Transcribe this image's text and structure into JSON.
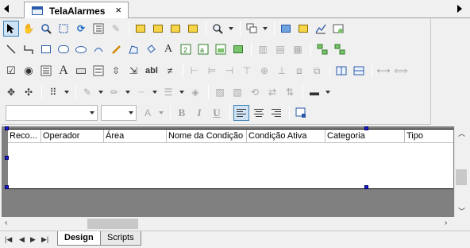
{
  "document_tab": {
    "title": "TelaAlarmes",
    "close_glyph": "×",
    "icon": "screen-window-icon"
  },
  "toolbar": {
    "row1_icons": [
      "pointer-arrow-icon",
      "hand-pan-icon",
      "zoom-icon",
      "refresh-icon",
      "list-checklist-icon",
      "clear-format-icon",
      "bring-forward-icon",
      "send-backward-icon",
      "bring-to-front-icon",
      "send-to-back-icon",
      "magnifier-zoom-icon",
      "dropdown-caret",
      "group-objects-icon",
      "dropdown-caret",
      "screen-properties-icon",
      "screen-resize-icon",
      "chart-icon",
      "object-wizard-icon"
    ],
    "row2_icons": [
      "line-icon",
      "polyline-icon",
      "rectangle-icon",
      "rounded-rectangle-icon",
      "ellipse-icon",
      "arc-icon",
      "pencil-icon",
      "polygon-icon",
      "bucket-fill-icon",
      "text-A-icon",
      "numeric-display-icon",
      "text-display-icon",
      "image-display-icon",
      "smart-object-icon",
      "align-left-grid-icon",
      "align-top-grid-icon",
      "tile-icon",
      "ungroup-icon"
    ],
    "row3_icons": [
      "checkbox-icon",
      "radio-button-icon",
      "listbox-icon",
      "text-big-A-icon",
      "button-icon",
      "combo-icon",
      "spin-icon",
      "edit-field-icon",
      "abl-text-icon",
      "slider-icon",
      "align-left-icon",
      "align-center-icon",
      "align-right-icon",
      "align-top-icon",
      "align-middle-icon",
      "align-bottom-icon",
      "space-horizontal-icon",
      "space-vertical-icon",
      "same-width-icon",
      "same-height-icon"
    ],
    "row4_icons": [
      "move-icon",
      "resize-icon",
      "grid-dots-icon",
      "line-color-icon",
      "text-color-icon",
      "line-style-icon",
      "line-width-icon",
      "fill-color-icon",
      "shadow-icon",
      "order-icon",
      "rotate-icon",
      "flip-icon",
      "border-icon"
    ],
    "abl_label": "abl",
    "text_a_label": "A",
    "font_combo_value": "",
    "size_combo_value": "",
    "bold_label": "B",
    "italic_label": "I",
    "underline_label": "U"
  },
  "grid": {
    "columns": [
      "Reco...",
      "Operador",
      "Área",
      "Nome da Condição",
      "Condição Ativa",
      "Categoria",
      "Tipo"
    ]
  },
  "sheet_tabs": [
    {
      "label": "Design",
      "active": true
    },
    {
      "label": "Scripts",
      "active": false
    }
  ],
  "colors": {
    "selection_accent": "#3c7fb1",
    "handle_blue": "#1a1ad8",
    "canvas_gray": "#808080"
  }
}
